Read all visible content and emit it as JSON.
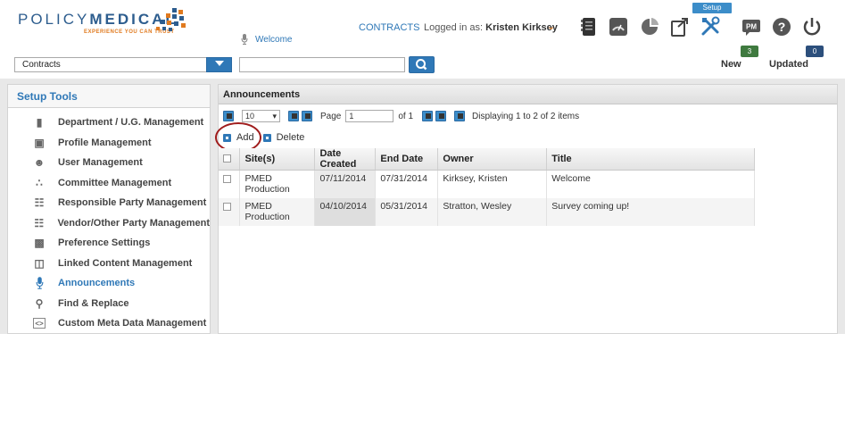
{
  "header": {
    "logo_text_light": "POLICY",
    "logo_text_bold": "MEDICAL",
    "logo_tagline": "EXPERIENCE YOU CAN TRUST",
    "welcome_label": "Welcome",
    "contracts_link": "CONTRACTS",
    "logged_in_prefix": "Logged in as:",
    "user_name": "Kristen Kirksey",
    "setup_badge": "Setup",
    "new_count": "3",
    "new_label": "New",
    "updated_count": "0",
    "updated_label": "Updated",
    "icons": [
      "document-stack-icon",
      "gauge-icon",
      "pie-chart-icon",
      "export-icon",
      "setup-tools-icon",
      "pm-chat-icon",
      "help-icon",
      "power-icon"
    ]
  },
  "toolbar": {
    "contracts_select_value": "Contracts",
    "search_value": ""
  },
  "sidebar": {
    "title": "Setup Tools",
    "items": [
      {
        "label": "Department / U.G. Management",
        "icon": "department-icon"
      },
      {
        "label": "Profile Management",
        "icon": "profile-icon"
      },
      {
        "label": "User Management",
        "icon": "user-icon"
      },
      {
        "label": "Committee Management",
        "icon": "committee-icon"
      },
      {
        "label": "Responsible Party Management",
        "icon": "responsible-party-icon"
      },
      {
        "label": "Vendor/Other Party Management",
        "icon": "vendor-icon"
      },
      {
        "label": "Preference Settings",
        "icon": "preferences-icon"
      },
      {
        "label": "Linked Content Management",
        "icon": "linked-content-icon"
      },
      {
        "label": "Announcements",
        "icon": "microphone-icon",
        "active": true
      },
      {
        "label": "Find & Replace",
        "icon": "find-replace-icon"
      },
      {
        "label": "Custom Meta Data Management",
        "icon": "code-icon"
      }
    ]
  },
  "main": {
    "title": "Announcements",
    "pager": {
      "page_size": "10",
      "page_label": "Page",
      "page_value": "1",
      "of_label": "of 1",
      "display_text": "Displaying 1 to 2 of 2 items"
    },
    "actions": {
      "add_label": "Add",
      "delete_label": "Delete"
    },
    "columns": [
      "Site(s)",
      "Date Created",
      "End Date",
      "Owner",
      "Title"
    ],
    "rows": [
      {
        "site": "PMED Production",
        "created": "07/11/2014",
        "end": "07/31/2014",
        "owner": "Kirksey, Kristen",
        "title": "Welcome"
      },
      {
        "site": "PMED Production",
        "created": "04/10/2014",
        "end": "05/31/2014",
        "owner": "Stratton, Wesley",
        "title": "Survey coming up!"
      }
    ]
  },
  "colors": {
    "accent_blue": "#2f78b7",
    "brand_orange": "#e07a1f",
    "highlight_circle": "#a01d1d"
  }
}
